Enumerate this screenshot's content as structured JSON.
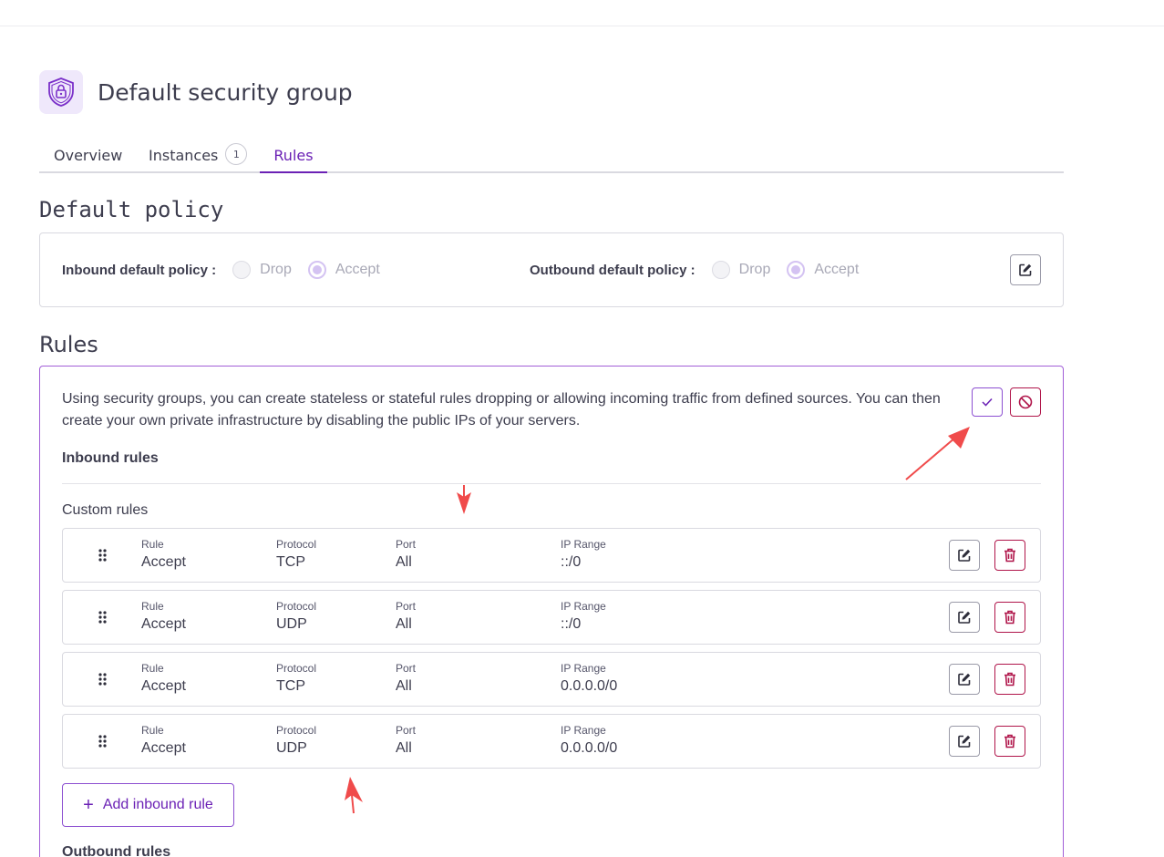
{
  "page": {
    "title": "Default security group"
  },
  "tabs": [
    {
      "label": "Overview"
    },
    {
      "label": "Instances",
      "badge": "1"
    },
    {
      "label": "Rules"
    }
  ],
  "default_policy": {
    "title": "Default policy",
    "inbound": {
      "label": "Inbound default policy :",
      "options": [
        "Drop",
        "Accept"
      ],
      "selected": "Accept"
    },
    "outbound": {
      "label": "Outbound default policy :",
      "options": [
        "Drop",
        "Accept"
      ],
      "selected": "Accept"
    }
  },
  "rules": {
    "title": "Rules",
    "description": "Using security groups, you can create stateless or stateful rules dropping or allowing incoming traffic from defined sources. You can then create your own private infrastructure by disabling the public IPs of your servers.",
    "inbound_title": "Inbound rules",
    "custom_rules_title": "Custom rules",
    "column_labels": {
      "rule": "Rule",
      "protocol": "Protocol",
      "port": "Port",
      "ip_range": "IP Range"
    },
    "inbound": [
      {
        "rule": "Accept",
        "protocol": "TCP",
        "port": "All",
        "ip_range": "::/0"
      },
      {
        "rule": "Accept",
        "protocol": "UDP",
        "port": "All",
        "ip_range": "::/0"
      },
      {
        "rule": "Accept",
        "protocol": "TCP",
        "port": "All",
        "ip_range": "0.0.0.0/0"
      },
      {
        "rule": "Accept",
        "protocol": "UDP",
        "port": "All",
        "ip_range": "0.0.0.0/0"
      }
    ],
    "add_inbound_label": "Add inbound rule",
    "outbound_title": "Outbound rules"
  },
  "colors": {
    "accent": "#6b21b5",
    "danger": "#b0154a",
    "annotation": "#f04b4b"
  }
}
